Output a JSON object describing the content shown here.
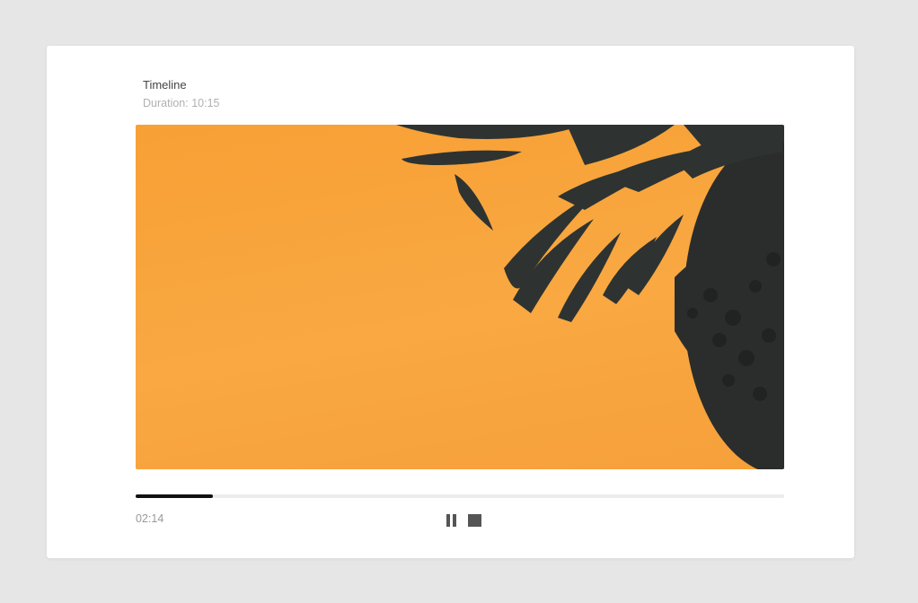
{
  "player": {
    "title": "Timeline",
    "duration_label": "Duration: 10:15",
    "current_time": "02:14",
    "progress_fraction": 0.119,
    "accent_color": "#111111",
    "video_bg_color": "#f8a43c"
  },
  "controls": {
    "pause_icon": "pause-icon",
    "stop_icon": "stop-icon"
  }
}
